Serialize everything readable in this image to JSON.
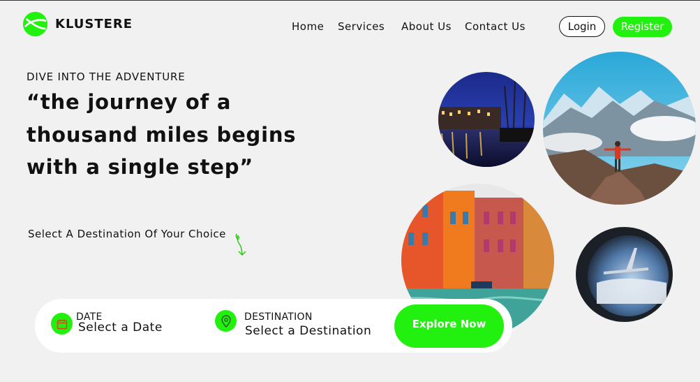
{
  "brand": {
    "name": "KLUSTERE",
    "accent": "#22f00e"
  },
  "nav": {
    "items": [
      "Home",
      "Services",
      "About Us",
      "Contact Us"
    ]
  },
  "auth": {
    "login": "Login",
    "register": "Register"
  },
  "hero": {
    "eyebrow": "DIVE INTO THE ADVENTURE",
    "quote_line1": "“the journey of a",
    "quote_line2": "thousand miles begins",
    "quote_line3": "with a single step”",
    "select_prompt": "Select A Destination Of Your Choice"
  },
  "search": {
    "date_label": "DATE",
    "date_value": "Select a Date",
    "destination_label": "DESTINATION",
    "destination_value": "Select a Destination",
    "explore": "Explore Now"
  },
  "icons": {
    "logo": "globe-logo-icon",
    "date": "calendar-icon",
    "destination": "map-pin-icon",
    "doodle": "curly-arrow-icon"
  }
}
